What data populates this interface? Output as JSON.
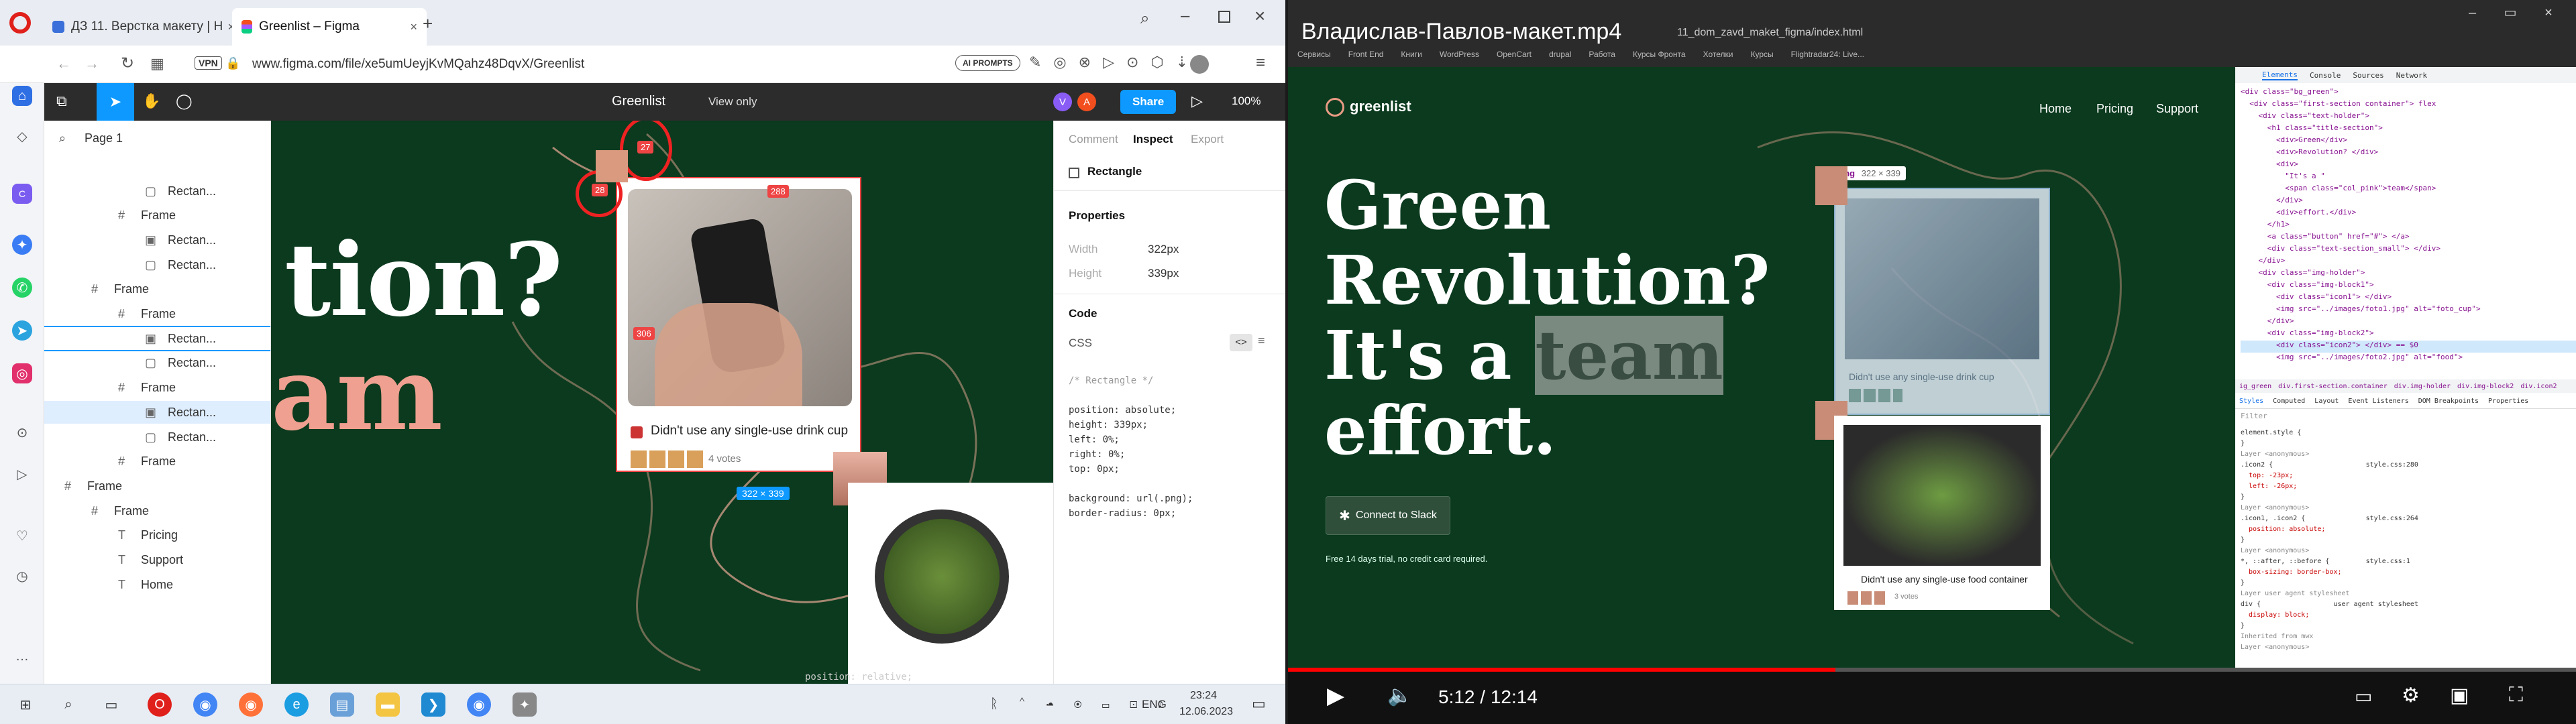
{
  "browser": {
    "tabs": [
      {
        "label": "ДЗ 11. Верстка макету | Н"
      },
      {
        "label": "Greenlist – Figma"
      }
    ],
    "url": "www.figma.com/file/xe5umUeyjKvMQahz48DqvX/Greenlist",
    "vpn_label": "VPN",
    "ai_prompts_label": "AI PROMPTS"
  },
  "figma": {
    "file_name": "Greenlist",
    "view_mode": "View only",
    "share_label": "Share",
    "zoom": "100%",
    "page_label": "Page 1",
    "avatars": [
      "V",
      "A"
    ],
    "layers": [
      {
        "label": "Rectan...",
        "indent": 3,
        "icon": "rect"
      },
      {
        "label": "Frame",
        "indent": 2,
        "icon": "frame"
      },
      {
        "label": "Rectan...",
        "indent": 3,
        "icon": "image"
      },
      {
        "label": "Rectan...",
        "indent": 3,
        "icon": "rect"
      },
      {
        "label": "Frame",
        "indent": 1,
        "icon": "frame"
      },
      {
        "label": "Frame",
        "indent": 2,
        "icon": "frame"
      },
      {
        "label": "Rectan...",
        "indent": 3,
        "icon": "image"
      },
      {
        "label": "Rectan...",
        "indent": 3,
        "icon": "rect"
      },
      {
        "label": "Frame",
        "indent": 2,
        "icon": "frame"
      },
      {
        "label": "Rectan...",
        "indent": 3,
        "icon": "image"
      },
      {
        "label": "Rectan...",
        "indent": 3,
        "icon": "rect"
      },
      {
        "label": "Frame",
        "indent": 2,
        "icon": "frame"
      },
      {
        "label": "Frame",
        "indent": 0,
        "icon": "frame"
      },
      {
        "label": "Frame",
        "indent": 1,
        "icon": "frame"
      },
      {
        "label": "Pricing",
        "indent": 2,
        "icon": "text"
      },
      {
        "label": "Support",
        "indent": 2,
        "icon": "text"
      },
      {
        "label": "Home",
        "indent": 2,
        "icon": "text"
      }
    ],
    "canvas": {
      "heading_line1": "tion?",
      "heading_line2": "am",
      "card_text": "Didn't use any single-use drink cup",
      "votes": "4 votes",
      "size_badge": "322 × 339",
      "measure_labels": [
        "27",
        "28",
        "288",
        "306"
      ]
    },
    "inspect": {
      "tabs": [
        "Comment",
        "Inspect",
        "Export"
      ],
      "layer_name": "Rectangle",
      "properties_title": "Properties",
      "width_label": "Width",
      "width_value": "322px",
      "height_label": "Height",
      "height_value": "339px",
      "code_title": "Code",
      "code_lang": "CSS",
      "code_lines": [
        "/* Rectangle */",
        "",
        "position: absolute;",
        "height: 339px;",
        "left: 0%;",
        "right: 0%;",
        "top: 0px;",
        "",
        "background: url(.png);",
        "border-radius: 0px;"
      ]
    },
    "status_fragment": "position: relative;"
  },
  "taskbar_left": {
    "lang": "ENG",
    "time": "23:24",
    "date": "12.06.2023"
  },
  "video": {
    "title": "Владислав-Павлов-макет.mp4",
    "time": "5:12 / 12:14",
    "progress": 0.425,
    "inner_url": "11_dom_zavd_maket_figma/index.html",
    "bookmarks": [
      "Сервисы",
      "Front End",
      "Книги",
      "WordPress",
      "OpenCart",
      "drupal",
      "Работа",
      "Курсы Фронта",
      "Хотелки",
      "Курсы",
      "Flightradar24: Live..."
    ]
  },
  "site": {
    "logo": "greenlist",
    "nav": [
      "Home",
      "Pricing",
      "Support"
    ],
    "hero_line1": "Green",
    "hero_line2": "Revolution?",
    "hero_line3_pre": "It's a ",
    "hero_line3_highlight": "team",
    "hero_line4": "effort.",
    "cta": "Connect to Slack",
    "note": "Free 14 days trial, no credit card required.",
    "img_tooltip": "img",
    "img_tooltip_size": "322 × 339",
    "card1_text": "Didn't use any single-use drink cup",
    "card2_text": "Didn't use any single-use food container",
    "card_votes": "3 votes"
  },
  "devtools": {
    "tabs": [
      "Elements",
      "Console",
      "Sources",
      "Network"
    ],
    "dom_lines": [
      "<div class=\"bg_green\">",
      "  <div class=\"first-section container\"> flex",
      "    <div class=\"text-holder\">",
      "      <h1 class=\"title-section\">",
      "        <div>Green</div>",
      "        <div>Revolution? </div>",
      "        <div>",
      "          \"It's a \"",
      "          <span class=\"col_pink\">team</span>",
      "        </div>",
      "        <div>effort.</div>",
      "      </h1>",
      "      <a class=\"button\" href=\"#\"> </a>",
      "      <div class=\"text-section_small\"> </div>",
      "    </div>",
      "    <div class=\"img-holder\">",
      "      <div class=\"img-block1\">",
      "        <div class=\"icon1\"> </div>",
      "        <img src=\"../images/foto1.jpg\" alt=\"foto_cup\">",
      "      </div>",
      "      <div class=\"img-block2\">",
      "        <div class=\"icon2\"> </div> == $0",
      "        <img src=\"../images/foto2.jpg\" alt=\"food\">"
    ],
    "breadcrumb": [
      "ig_green",
      "div.first-section.container",
      "div.img-holder",
      "div.img-block2",
      "div.icon2"
    ],
    "style_tabs": [
      "Styles",
      "Computed",
      "Layout",
      "Event Listeners",
      "DOM Breakpoints",
      "Properties"
    ],
    "filter_placeholder": "Filter",
    "style_rules": [
      "element.style {",
      "}",
      "Layer <anonymous>",
      ".icon2 {                       style.css:280",
      "  top: -23px;",
      "  left: -26px;",
      "}",
      "Layer <anonymous>",
      ".icon1, .icon2 {               style.css:264",
      "  position: absolute;",
      "}",
      "Layer <anonymous>",
      "*, ::after, ::before {         style.css:1",
      "  box-sizing: border-box;",
      "}",
      "Layer user agent stylesheet",
      "div {                  user agent stylesheet",
      "  display: block;",
      "}",
      "Inherited from mwx",
      "Layer <anonymous>"
    ]
  },
  "colors": {
    "figma_bg": "#0b3a1e",
    "accent_pink": "#f0a090",
    "figma_blue": "#0d99ff",
    "progress_red": "#ff0000"
  }
}
